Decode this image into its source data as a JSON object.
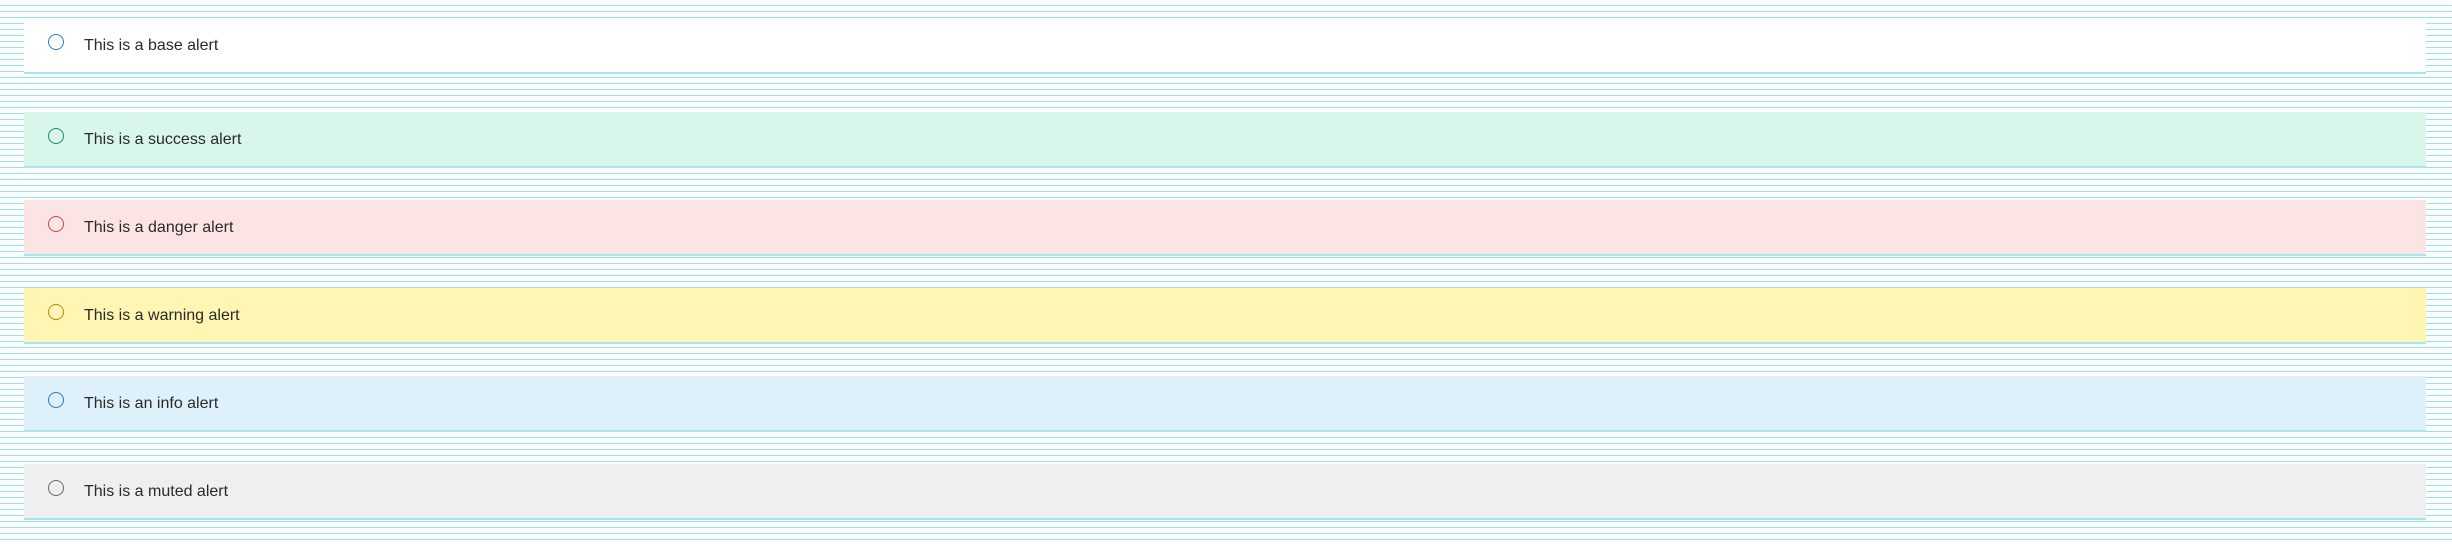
{
  "alerts": [
    {
      "variant": "base",
      "text": "This is a base alert",
      "icon": "circle-outline-icon",
      "background": "#ffffff",
      "icon_color": "#1a85b8"
    },
    {
      "variant": "success",
      "text": "This is a success alert",
      "icon": "circle-outline-icon",
      "background": "#d8f7ea",
      "icon_color": "#1f8a66"
    },
    {
      "variant": "danger",
      "text": "This is a danger alert",
      "icon": "circle-outline-icon",
      "background": "#fde4e4",
      "icon_color": "#d2463f"
    },
    {
      "variant": "warning",
      "text": "This is a warning alert",
      "icon": "circle-outline-icon",
      "background": "#fef6b2",
      "icon_color": "#b88616"
    },
    {
      "variant": "info",
      "text": "This is an info alert",
      "icon": "circle-outline-icon",
      "background": "#def1fb",
      "icon_color": "#1a85b8"
    },
    {
      "variant": "muted",
      "text": "This is a muted alert",
      "icon": "circle-outline-icon",
      "background": "#f0efef",
      "icon_color": "#6a6a6a"
    }
  ]
}
